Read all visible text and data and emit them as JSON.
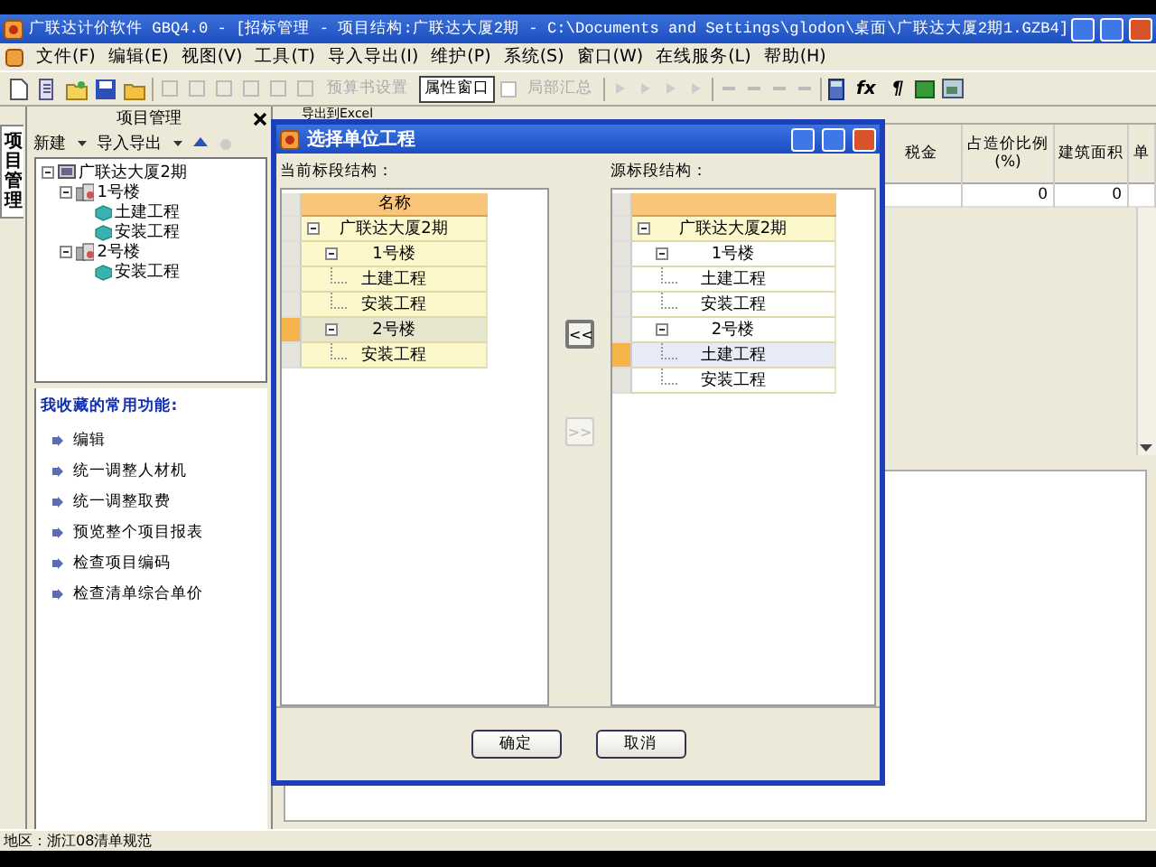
{
  "window": {
    "title": "广联达计价软件 GBQ4.0 - [招标管理 - 项目结构:广联达大厦2期 - C:\\Documents and Settings\\glodon\\桌面\\广联达大厦2期1.GZB4]"
  },
  "menu": [
    "文件(F)",
    "编辑(E)",
    "视图(V)",
    "工具(T)",
    "导入导出(I)",
    "维护(P)",
    "系统(S)",
    "窗口(W)",
    "在线服务(L)",
    "帮助(H)"
  ],
  "toolbar": [
    {
      "kind": "button",
      "label": "预算书设置",
      "disabled": true,
      "on": false
    },
    {
      "kind": "button",
      "label": "属性窗口",
      "disabled": false,
      "on": true
    },
    {
      "kind": "check",
      "label": "局部汇总",
      "disabled": true,
      "on": false
    },
    {
      "kind": "glyph",
      "label": "fx",
      "disabled": false,
      "on": false
    },
    {
      "kind": "glyph",
      "label": "¶",
      "disabled": false,
      "on": false
    }
  ],
  "side_tab": {
    "label": "项目管理",
    "selected": true
  },
  "project_panel": {
    "title": "项目管理",
    "actions": [
      "新建",
      "导入导出"
    ],
    "tree": [
      {
        "label": "广联达大厦2期",
        "kind": "project",
        "expanded": true,
        "children": [
          {
            "label": "1号楼",
            "kind": "building",
            "expanded": true,
            "children": [
              {
                "label": "土建工程",
                "kind": "unit"
              },
              {
                "label": "安装工程",
                "kind": "unit"
              }
            ]
          },
          {
            "label": "2号楼",
            "kind": "building",
            "expanded": true,
            "children": [
              {
                "label": "安装工程",
                "kind": "unit"
              }
            ]
          }
        ]
      }
    ]
  },
  "favorites": {
    "title": "我收藏的常用功能:",
    "items": [
      "编辑",
      "统一调整人材机",
      "统一调整取费",
      "预览整个项目报表",
      "检查项目编码",
      "检查清单综合单价"
    ]
  },
  "main_tab": {
    "label": "导出到Excel"
  },
  "grid": {
    "columns": [
      "税金",
      "占造价比例\n(%)",
      "建筑面积",
      "单"
    ],
    "rows": [
      [
        null,
        "0",
        "0",
        null
      ]
    ]
  },
  "dialog": {
    "title": "选择单位工程",
    "left": {
      "label": "当前标段结构：",
      "header": "名称",
      "tree": [
        {
          "label": "广联达大厦2期",
          "selected": false,
          "children": [
            {
              "label": "1号楼",
              "selected": false,
              "children": [
                {
                  "label": "土建工程",
                  "selected": false
                },
                {
                  "label": "安装工程",
                  "selected": false
                }
              ]
            },
            {
              "label": "2号楼",
              "selected": true,
              "children": [
                {
                  "label": "安装工程",
                  "selected": false
                }
              ]
            }
          ]
        }
      ]
    },
    "right": {
      "label": "源标段结构：",
      "tree": [
        {
          "label": "广联达大厦2期",
          "selected": false,
          "children": [
            {
              "label": "1号楼",
              "selected": false,
              "children": [
                {
                  "label": "土建工程",
                  "selected": false
                },
                {
                  "label": "安装工程",
                  "selected": false
                }
              ]
            },
            {
              "label": "2号楼",
              "selected": false,
              "children": [
                {
                  "label": "土建工程",
                  "selected": true
                },
                {
                  "label": "安装工程",
                  "selected": false
                }
              ]
            }
          ]
        }
      ]
    },
    "move_buttons": [
      {
        "label": "<<",
        "disabled": false
      },
      {
        "label": ">>",
        "disabled": true
      }
    ],
    "buttons": [
      "确定",
      "取消"
    ]
  },
  "status_bar": {
    "region": "地区：浙江08清单规范"
  }
}
